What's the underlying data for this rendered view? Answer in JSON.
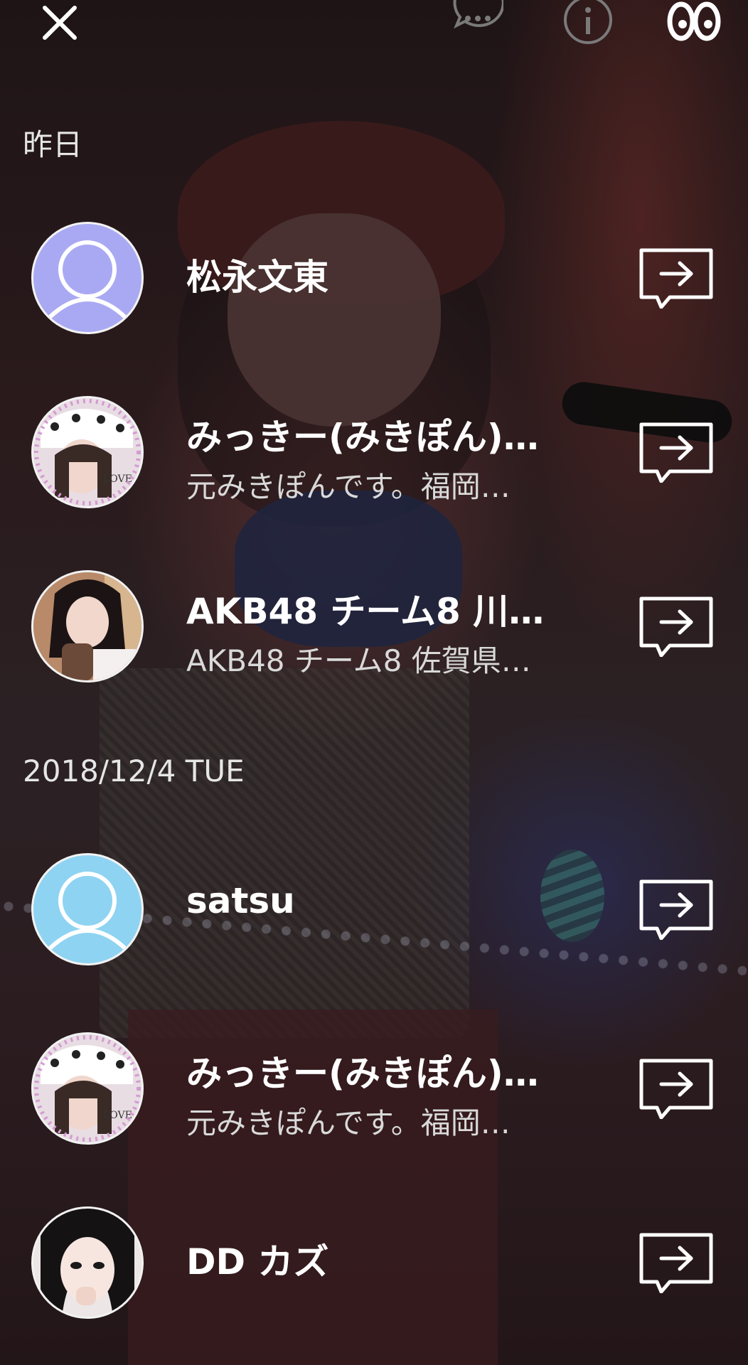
{
  "topbar": {
    "close_icon": "close-icon",
    "chat_icon": "chat-bubble-icon",
    "info_icon": "info-icon",
    "friends_icon": "recent-icon"
  },
  "sections": [
    {
      "date": "昨日",
      "items": [
        {
          "name": "松永文東",
          "status": "",
          "avatar": "default-avatar-purple",
          "avatar_color": "#a9a9f3"
        },
        {
          "name": "みっきー(みきぽん)…",
          "status": "元みきぽんです。福岡…",
          "avatar": "photo-avatar-mikki"
        },
        {
          "name": "AKB48 チーム8 川…",
          "status": "AKB48 チーム8 佐賀県…",
          "avatar": "photo-avatar-akb48"
        }
      ]
    },
    {
      "date": "2018/12/4 TUE",
      "items": [
        {
          "name": "satsu",
          "status": "",
          "avatar": "default-avatar-blue",
          "avatar_color": "#8ed3f2"
        },
        {
          "name": "みっきー(みきぽん)…",
          "status": "元みきぽんです。福岡…",
          "avatar": "photo-avatar-mikki"
        },
        {
          "name": "DD カズ",
          "status": "",
          "avatar": "photo-avatar-dd"
        }
      ]
    }
  ],
  "share_icon": "share-message-icon"
}
